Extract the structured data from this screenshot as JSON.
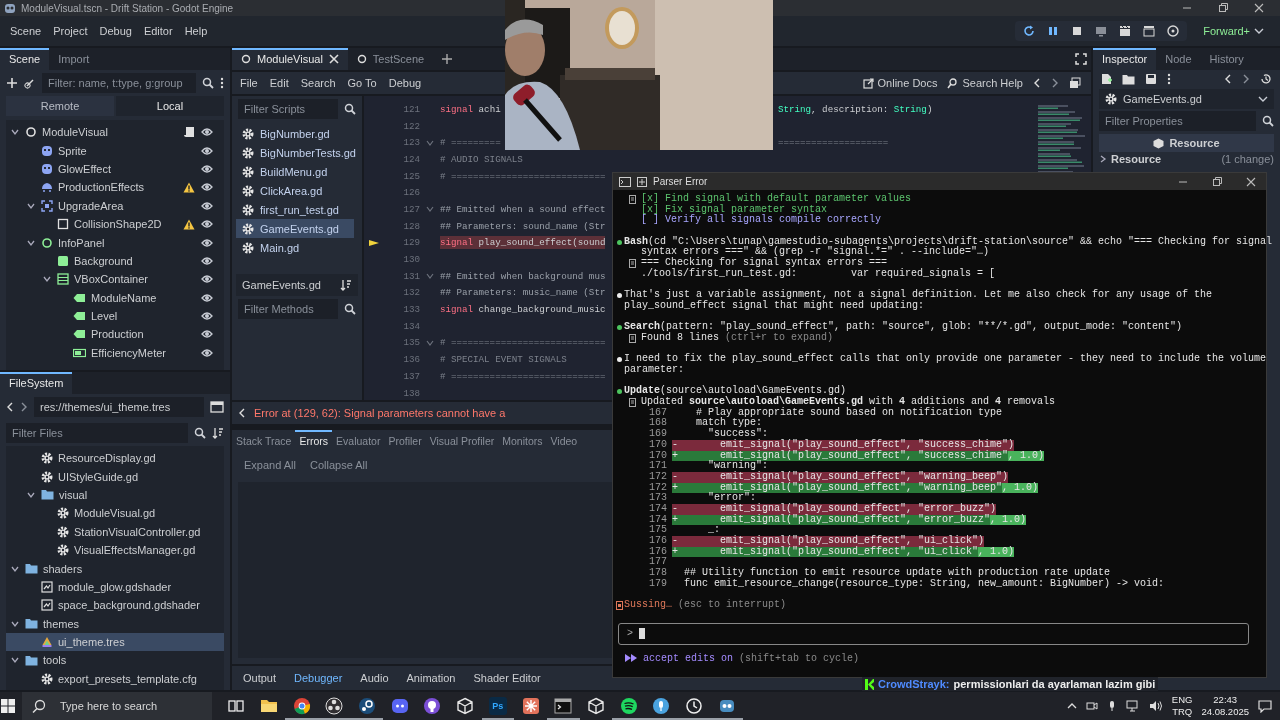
{
  "window": {
    "title": "ModuleVisual.tscn - Drift Station - Godot Engine"
  },
  "menu": [
    "Scene",
    "Project",
    "Debug",
    "Editor",
    "Help"
  ],
  "renderer": "Forward+",
  "scene_dock": {
    "tabs": [
      {
        "label": "Scene",
        "selected": true
      },
      {
        "label": "Import",
        "selected": false
      }
    ],
    "filter": {
      "placeholder": "Filter: name, t:type, g:group"
    },
    "modes": [
      {
        "label": "Remote",
        "selected": false
      },
      {
        "label": "Local",
        "selected": true
      }
    ],
    "tree": [
      {
        "name": "ModuleVisual",
        "kind": "node",
        "expanded": true,
        "script": true,
        "warning": false,
        "children": [
          {
            "name": "Sprite",
            "kind": "sprite",
            "script": false,
            "warning": false
          },
          {
            "name": "GlowEffect",
            "kind": "sprite",
            "script": false,
            "warning": false
          },
          {
            "name": "ProductionEffects",
            "kind": "particles",
            "script": false,
            "warning": true
          },
          {
            "name": "UpgradeArea",
            "kind": "area",
            "expanded": true,
            "script": false,
            "warning": false,
            "children": [
              {
                "name": "CollisionShape2D",
                "kind": "shape",
                "script": false,
                "warning": true
              }
            ]
          },
          {
            "name": "InfoPanel",
            "kind": "control",
            "expanded": true,
            "script": false,
            "warning": false,
            "children": [
              {
                "name": "Background",
                "kind": "panel",
                "script": false,
                "warning": false
              },
              {
                "name": "VBoxContainer",
                "kind": "vbox",
                "expanded": true,
                "script": false,
                "warning": false,
                "children": [
                  {
                    "name": "ModuleName",
                    "kind": "label",
                    "script": false,
                    "warning": false
                  },
                  {
                    "name": "Level",
                    "kind": "label",
                    "script": false,
                    "warning": false
                  },
                  {
                    "name": "Production",
                    "kind": "label",
                    "script": false,
                    "warning": false
                  },
                  {
                    "name": "EfficiencyMeter",
                    "kind": "meter",
                    "script": false,
                    "warning": false
                  }
                ]
              }
            ]
          }
        ]
      }
    ]
  },
  "filesystem": {
    "title": "FileSystem",
    "path": "res://themes/ui_theme.tres",
    "filter": {
      "placeholder": "Filter Files"
    },
    "partial_items": [
      {
        "name": "ResourceDisplay.gd",
        "kind": "script",
        "selected": false
      },
      {
        "name": "UIStyleGuide.gd",
        "kind": "script",
        "selected": false
      },
      {
        "name": "visual",
        "kind": "folder",
        "expanded": true,
        "selected": false,
        "children": [
          {
            "name": "ModuleVisual.gd",
            "kind": "script",
            "selected": false
          },
          {
            "name": "StationVisualController.gd",
            "kind": "script",
            "selected": false
          },
          {
            "name": "VisualEffectsManager.gd",
            "kind": "script",
            "selected": false
          }
        ]
      }
    ],
    "items": [
      {
        "name": "shaders",
        "kind": "folder",
        "expanded": true,
        "selected": false,
        "children": [
          {
            "name": "module_glow.gdshader",
            "kind": "shader",
            "selected": false
          },
          {
            "name": "space_background.gdshader",
            "kind": "shader",
            "selected": false
          }
        ]
      },
      {
        "name": "themes",
        "kind": "folder",
        "expanded": true,
        "selected": false,
        "children": [
          {
            "name": "ui_theme.tres",
            "kind": "theme",
            "selected": true
          }
        ]
      },
      {
        "name": "tools",
        "kind": "folder",
        "expanded": true,
        "selected": false,
        "children": [
          {
            "name": "export_presets_template.cfg",
            "kind": "config",
            "selected": false
          }
        ]
      }
    ]
  },
  "editor_tabs": [
    {
      "label": "ModuleVisual",
      "selected": true
    },
    {
      "label": "TestScene",
      "selected": false
    }
  ],
  "script_menu": [
    "File",
    "Edit",
    "Search",
    "Go To",
    "Debug"
  ],
  "help_links": [
    "Online Docs",
    "Search Help"
  ],
  "scripts": {
    "filter": {
      "placeholder": "Filter Scripts"
    },
    "items": [
      {
        "name": "BigNumber.gd",
        "selected": false
      },
      {
        "name": "BigNumberTests.gd",
        "selected": false
      },
      {
        "name": "BuildMenu.gd",
        "selected": false
      },
      {
        "name": "ClickArea.gd",
        "selected": false
      },
      {
        "name": "first_run_test.gd",
        "selected": false
      },
      {
        "name": "GameEvents.gd",
        "selected": true
      },
      {
        "name": "Main.gd",
        "selected": false
      }
    ],
    "current": "GameEvents.gd",
    "methods_filter": {
      "placeholder": "Filter Methods"
    }
  },
  "editor": {
    "lines": [
      {
        "number": "121",
        "fold": false,
        "error": false,
        "segments": [
          {
            "kind": "keyword",
            "text": "signal"
          },
          {
            "kind": "plain",
            "text": " achi"
          }
        ],
        "tail": [
          {
            "kind": "type",
            "text": "String"
          },
          {
            "kind": "plain",
            "text": ", description: "
          },
          {
            "kind": "type",
            "text": "String"
          },
          {
            "kind": "plain",
            "text": ")"
          }
        ]
      },
      {
        "number": "122",
        "fold": false,
        "error": false
      },
      {
        "number": "123",
        "fold": true,
        "error": false,
        "segments": [
          {
            "kind": "comment",
            "text": "# ========="
          }
        ],
        "tail": [
          {
            "kind": "comment",
            "text": "===================="
          }
        ]
      },
      {
        "number": "124",
        "fold": false,
        "error": false,
        "segments": [
          {
            "kind": "comment",
            "text": "# AUDIO SIGNALS"
          }
        ]
      },
      {
        "number": "125",
        "fold": false,
        "error": false,
        "segments": [
          {
            "kind": "comment",
            "text": "# ============================"
          }
        ]
      },
      {
        "number": "126",
        "fold": false,
        "error": false
      },
      {
        "number": "127",
        "fold": true,
        "error": false,
        "segments": [
          {
            "kind": "doc",
            "text": "## Emitted when a sound effect"
          }
        ]
      },
      {
        "number": "128",
        "fold": false,
        "error": false,
        "segments": [
          {
            "kind": "doc",
            "text": "## Parameters: sound_name (Str"
          }
        ]
      },
      {
        "number": "129",
        "fold": false,
        "error": true,
        "segments": [
          {
            "kind": "keyword",
            "text": "signal"
          },
          {
            "kind": "plain",
            "text": " play_sound_effect(sound"
          }
        ]
      },
      {
        "number": "130",
        "fold": false,
        "error": false
      },
      {
        "number": "131",
        "fold": true,
        "error": false,
        "segments": [
          {
            "kind": "doc",
            "text": "## Emitted when background mus"
          }
        ]
      },
      {
        "number": "132",
        "fold": false,
        "error": false,
        "segments": [
          {
            "kind": "doc",
            "text": "## Parameters: music_name (Str"
          }
        ]
      },
      {
        "number": "133",
        "fold": false,
        "error": false,
        "segments": [
          {
            "kind": "keyword",
            "text": "signal"
          },
          {
            "kind": "plain",
            "text": " change_background_music"
          }
        ]
      },
      {
        "number": "134",
        "fold": false,
        "error": false
      },
      {
        "number": "135",
        "fold": true,
        "error": false,
        "segments": [
          {
            "kind": "comment",
            "text": "# ============================"
          }
        ]
      },
      {
        "number": "136",
        "fold": false,
        "error": false,
        "segments": [
          {
            "kind": "comment",
            "text": "# SPECIAL EVENT SIGNALS"
          }
        ]
      },
      {
        "number": "137",
        "fold": false,
        "error": false,
        "segments": [
          {
            "kind": "comment",
            "text": "# ============================"
          }
        ]
      },
      {
        "number": "138",
        "fold": false,
        "error": false
      }
    ],
    "error_message": "Error at (129, 62): Signal parameters cannot have a"
  },
  "debugger": {
    "tabs": [
      {
        "label": "Stack Trace",
        "selected": false
      },
      {
        "label": "Errors",
        "selected": true
      },
      {
        "label": "Evaluator",
        "selected": false
      },
      {
        "label": "Profiler",
        "selected": false
      },
      {
        "label": "Visual Profiler",
        "selected": false
      },
      {
        "label": "Monitors",
        "selected": false
      },
      {
        "label": "Video",
        "selected": false
      }
    ],
    "buttons": [
      "Expand All",
      "Collapse All"
    ]
  },
  "bottom_tabs": [
    {
      "label": "Output",
      "selected": false
    },
    {
      "label": "Debugger",
      "selected": true
    },
    {
      "label": "Audio",
      "selected": false
    },
    {
      "label": "Animation",
      "selected": false
    },
    {
      "label": "Shader Editor",
      "selected": false
    }
  ],
  "inspector": {
    "tabs": [
      {
        "label": "Inspector",
        "selected": true
      },
      {
        "label": "Node",
        "selected": false
      },
      {
        "label": "History",
        "selected": false
      }
    ],
    "resource": "GameEvents.gd",
    "filter": {
      "placeholder": "Filter Properties"
    },
    "header": "Resource",
    "section": {
      "label": "Resource",
      "note": "(1 change)"
    }
  },
  "terminal": {
    "title": "Parser Error",
    "lines": [
      {
        "kind": "todo",
        "checked": true,
        "box": "[x]",
        "text": "Find signal with default parameter values"
      },
      {
        "kind": "todo",
        "checked": true,
        "box": "[x]",
        "text": "Fix signal parameter syntax"
      },
      {
        "kind": "todo",
        "checked": false,
        "box": "[ ]",
        "text": "Verify all signals compile correctly"
      },
      {
        "kind": "blank"
      },
      {
        "kind": "tool",
        "name": "Bash",
        "args": "(cd \"C:\\Users\\tunap\\gamestudio-subagents\\projects\\drift-station\\source\" && echo \"=== Checking for signal"
      },
      {
        "kind": "cont",
        "text": "syntax errors ===\" && (grep -r \"signal.*=\" . --include=\"…)"
      },
      {
        "kind": "output",
        "text": "=== Checking for signal syntax errors ==="
      },
      {
        "kind": "output",
        "text": "./tools/first_run_test.gd:         var required_signals = ["
      },
      {
        "kind": "blank"
      },
      {
        "kind": "message",
        "text": "That's just a variable assignment, not a signal definition. Let me also check for any usage of the"
      },
      {
        "kind": "message-cont",
        "text": "play_sound_effect signal that might need updating:"
      },
      {
        "kind": "blank"
      },
      {
        "kind": "tool",
        "name": "Search",
        "args": "(pattern: \"play_sound_effect\", path: \"source\", glob: \"**/*.gd\", output_mode: \"content\")"
      },
      {
        "kind": "output",
        "text": "Found 8 lines",
        "hint": "(ctrl+r to expand)"
      },
      {
        "kind": "blank"
      },
      {
        "kind": "message",
        "text": "I need to fix the play_sound_effect calls that only provide one parameter - they need to include the volume"
      },
      {
        "kind": "message-cont",
        "text": "parameter:"
      },
      {
        "kind": "blank"
      },
      {
        "kind": "tool",
        "name": "Update",
        "args": "(source\\autoload\\GameEvents.gd)"
      },
      {
        "kind": "output",
        "text": "Updated **source\\autoload\\GameEvents.gd** with **4** additions and **4** removals"
      },
      {
        "kind": "diff",
        "number": "167",
        "text": "  # Play appropriate sound based on notification type"
      },
      {
        "kind": "diff",
        "number": "168",
        "text": "  match type:"
      },
      {
        "kind": "diff",
        "number": "169",
        "text": "    \"success\":"
      },
      {
        "kind": "diff-removed",
        "number": "170",
        "sign": "-",
        "text": "      emit_signal(\"play_sound_effect\", \"success_chime\")"
      },
      {
        "kind": "diff-added",
        "number": "170",
        "sign": "+",
        "text": "      emit_signal(\"play_sound_effect\", \"success_chime\"",
        "extra": ", 1.0)"
      },
      {
        "kind": "diff",
        "number": "171",
        "text": "    \"warning\":"
      },
      {
        "kind": "diff-removed",
        "number": "172",
        "sign": "-",
        "text": "      emit_signal(\"play_sound_effect\", \"warning_beep\")"
      },
      {
        "kind": "diff-added",
        "number": "172",
        "sign": "+",
        "text": "      emit_signal(\"play_sound_effect\", \"warning_beep\"",
        "extra": ", 1.0)"
      },
      {
        "kind": "diff",
        "number": "173",
        "text": "    \"error\":"
      },
      {
        "kind": "diff-removed",
        "number": "174",
        "sign": "-",
        "text": "      emit_signal(\"play_sound_effect\", \"error_buzz\")"
      },
      {
        "kind": "diff-added",
        "number": "174",
        "sign": "+",
        "text": "      emit_signal(\"play_sound_effect\", \"error_buzz\"",
        "extra": ", 1.0)"
      },
      {
        "kind": "diff",
        "number": "175",
        "text": "    _:"
      },
      {
        "kind": "diff-removed",
        "number": "176",
        "sign": "-",
        "text": "      emit_signal(\"play_sound_effect\", \"ui_click\")"
      },
      {
        "kind": "diff-added",
        "number": "176",
        "sign": "+",
        "text": "      emit_signal(\"play_sound_effect\", \"ui_click\"",
        "extra": ", 1.0)"
      },
      {
        "kind": "diff",
        "number": "177"
      },
      {
        "kind": "diff",
        "number": "178",
        "text": "## Utility function to emit resource update with production rate update"
      },
      {
        "kind": "diff",
        "number": "179",
        "text": "func emit_resource_change(resource_type: String, new_amount: BigNumber) -> void:"
      },
      {
        "kind": "blank"
      },
      {
        "kind": "status",
        "text": "Sussing…",
        "hint": "(esc to interrupt)"
      }
    ],
    "prompt": ">",
    "mode": {
      "label": "accept edits on",
      "hint": "(shift+tab to cycle)"
    }
  },
  "chat": {
    "user": "CrowdStrayk:",
    "message": "permissionlari da ayarlaman lazim gibi"
  },
  "taskbar": {
    "search": {
      "placeholder": "Type here to search"
    },
    "apps": [
      {
        "kind": "task-view",
        "running": false
      },
      {
        "kind": "folder",
        "running": false
      },
      {
        "kind": "chrome",
        "running": true
      },
      {
        "kind": "obs",
        "running": true
      },
      {
        "kind": "steam",
        "running": true
      },
      {
        "kind": "discord",
        "running": false
      },
      {
        "kind": "github",
        "running": false
      },
      {
        "kind": "cube",
        "running": false
      },
      {
        "kind": "photoshop",
        "label": "Ps",
        "running": true
      },
      {
        "kind": "spark",
        "running": false
      },
      {
        "kind": "terminal",
        "running": true
      },
      {
        "kind": "cube",
        "running": false
      },
      {
        "kind": "spotify",
        "running": true
      },
      {
        "kind": "mic",
        "running": true
      },
      {
        "kind": "clock",
        "running": true
      },
      {
        "kind": "godot",
        "running": true
      }
    ],
    "language": [
      "ENG",
      "TRQ"
    ],
    "time": "22:43",
    "date": "24.08.2025"
  }
}
